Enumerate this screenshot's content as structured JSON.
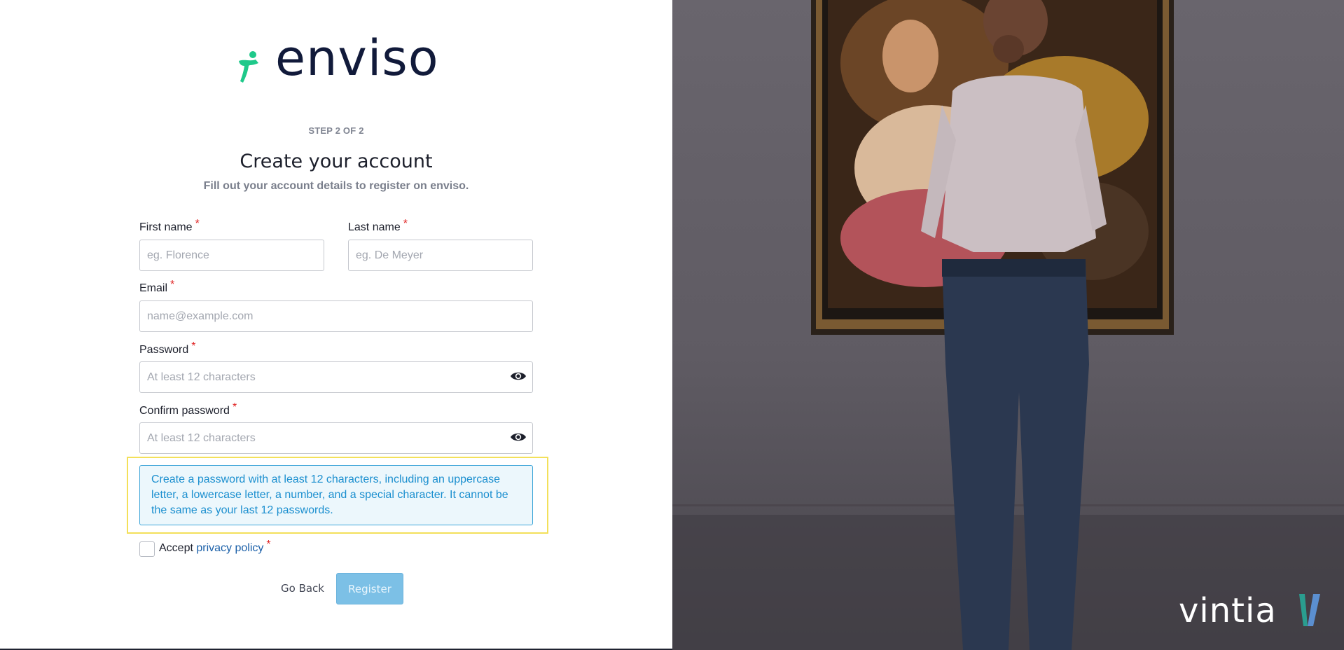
{
  "brand": {
    "name": "enviso",
    "accent_color": "#1ec98a",
    "text_color": "#111a3a"
  },
  "header": {
    "step": "STEP 2 OF 2",
    "title": "Create your account",
    "subtitle": "Fill out your account details to register on enviso."
  },
  "form": {
    "required_mark": "*",
    "first_name": {
      "label": "First name",
      "placeholder": "eg. Florence",
      "value": ""
    },
    "last_name": {
      "label": "Last name",
      "placeholder": "eg. De Meyer",
      "value": ""
    },
    "email": {
      "label": "Email",
      "placeholder": "name@example.com",
      "value": ""
    },
    "password": {
      "label": "Password",
      "placeholder": "At least 12 characters",
      "value": "",
      "toggle_icon": "eye-icon"
    },
    "confirm_password": {
      "label": "Confirm password",
      "placeholder": "At least 12 characters",
      "value": "",
      "toggle_icon": "eye-icon"
    },
    "password_hint": "Create a password with at least 12 characters, including an uppercase letter, a lowercase letter, a number, and a special character. It cannot be the same as your last 12 passwords.",
    "accept": {
      "prefix": "Accept",
      "link_text": "privacy policy",
      "checked": false
    }
  },
  "actions": {
    "back_label": "Go Back",
    "register_label": "Register",
    "register_enabled": false
  },
  "side_panel": {
    "logo_text": "vintia",
    "logo_colors": [
      "#2a9d8f",
      "#5b8fd0"
    ]
  }
}
